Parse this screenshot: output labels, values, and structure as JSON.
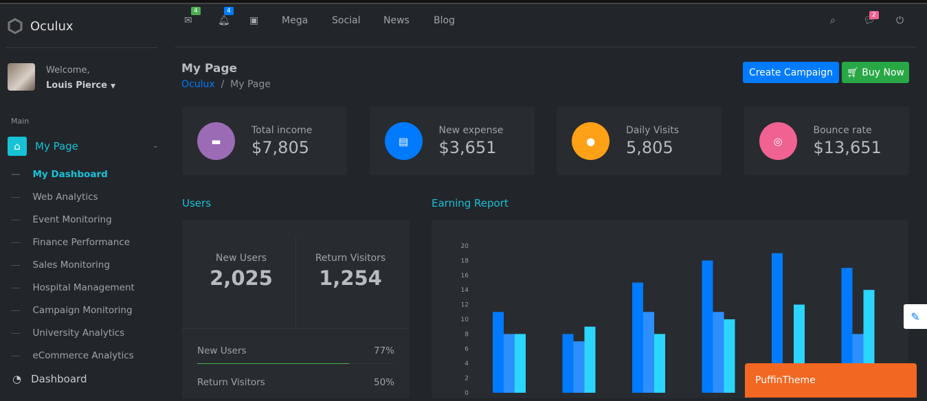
{
  "brand": "Oculux",
  "user": {
    "welcome": "Welcome,",
    "name": "Louis Pierce"
  },
  "sidebar": {
    "section": "Main",
    "parent": "My Page",
    "items": [
      "My Dashboard",
      "Web Analytics",
      "Event Monitoring",
      "Finance Performance",
      "Sales Monitoring",
      "Hospital Management",
      "Campaign Monitoring",
      "University Analytics",
      "eCommerce Analytics"
    ],
    "next": "Dashboard"
  },
  "nav": {
    "mail_badge": "4",
    "bell_badge": "4",
    "links": [
      "Mega",
      "Social",
      "News",
      "Blog"
    ],
    "chat_badge": "2"
  },
  "page": {
    "title": "My Page",
    "crumb_root": "Oculux",
    "crumb_current": "My Page",
    "create": "Create Campaign",
    "buy": "Buy Now"
  },
  "stats": [
    {
      "label": "Total income",
      "value": "$7,805",
      "color": "#9b6bb5",
      "icon": "briefcase-icon"
    },
    {
      "label": "New expense",
      "value": "$3,651",
      "color": "#007bff",
      "icon": "credit-card-icon"
    },
    {
      "label": "Daily Visits",
      "value": "5,805",
      "color": "#ffa117",
      "icon": "users-icon"
    },
    {
      "label": "Bounce rate",
      "value": "$13,651",
      "color": "#f06292",
      "icon": "lifebuoy-icon"
    }
  ],
  "users": {
    "title": "Users",
    "new_label": "New Users",
    "new_value": "2,025",
    "ret_label": "Return Visitors",
    "ret_value": "1,254",
    "progress": [
      {
        "label": "New Users",
        "pct": "77%",
        "value": 77
      },
      {
        "label": "Return Visitors",
        "pct": "50%",
        "value": 50
      }
    ]
  },
  "earning": {
    "title": "Earning Report"
  },
  "chart_data": {
    "type": "bar",
    "ylim": [
      0,
      20
    ],
    "yticks": [
      0,
      2,
      4,
      6,
      8,
      10,
      12,
      14,
      16,
      18,
      20
    ],
    "colors": [
      "#007bff",
      "#2d8ffc",
      "#2bd5fd"
    ],
    "series": [
      {
        "values": [
          11,
          8,
          15,
          18,
          19,
          17
        ]
      },
      {
        "values": [
          8,
          7,
          11,
          11,
          null,
          8
        ]
      },
      {
        "values": [
          8,
          9,
          8,
          10,
          12,
          14
        ]
      }
    ]
  },
  "puffin": "PuffinTheme"
}
